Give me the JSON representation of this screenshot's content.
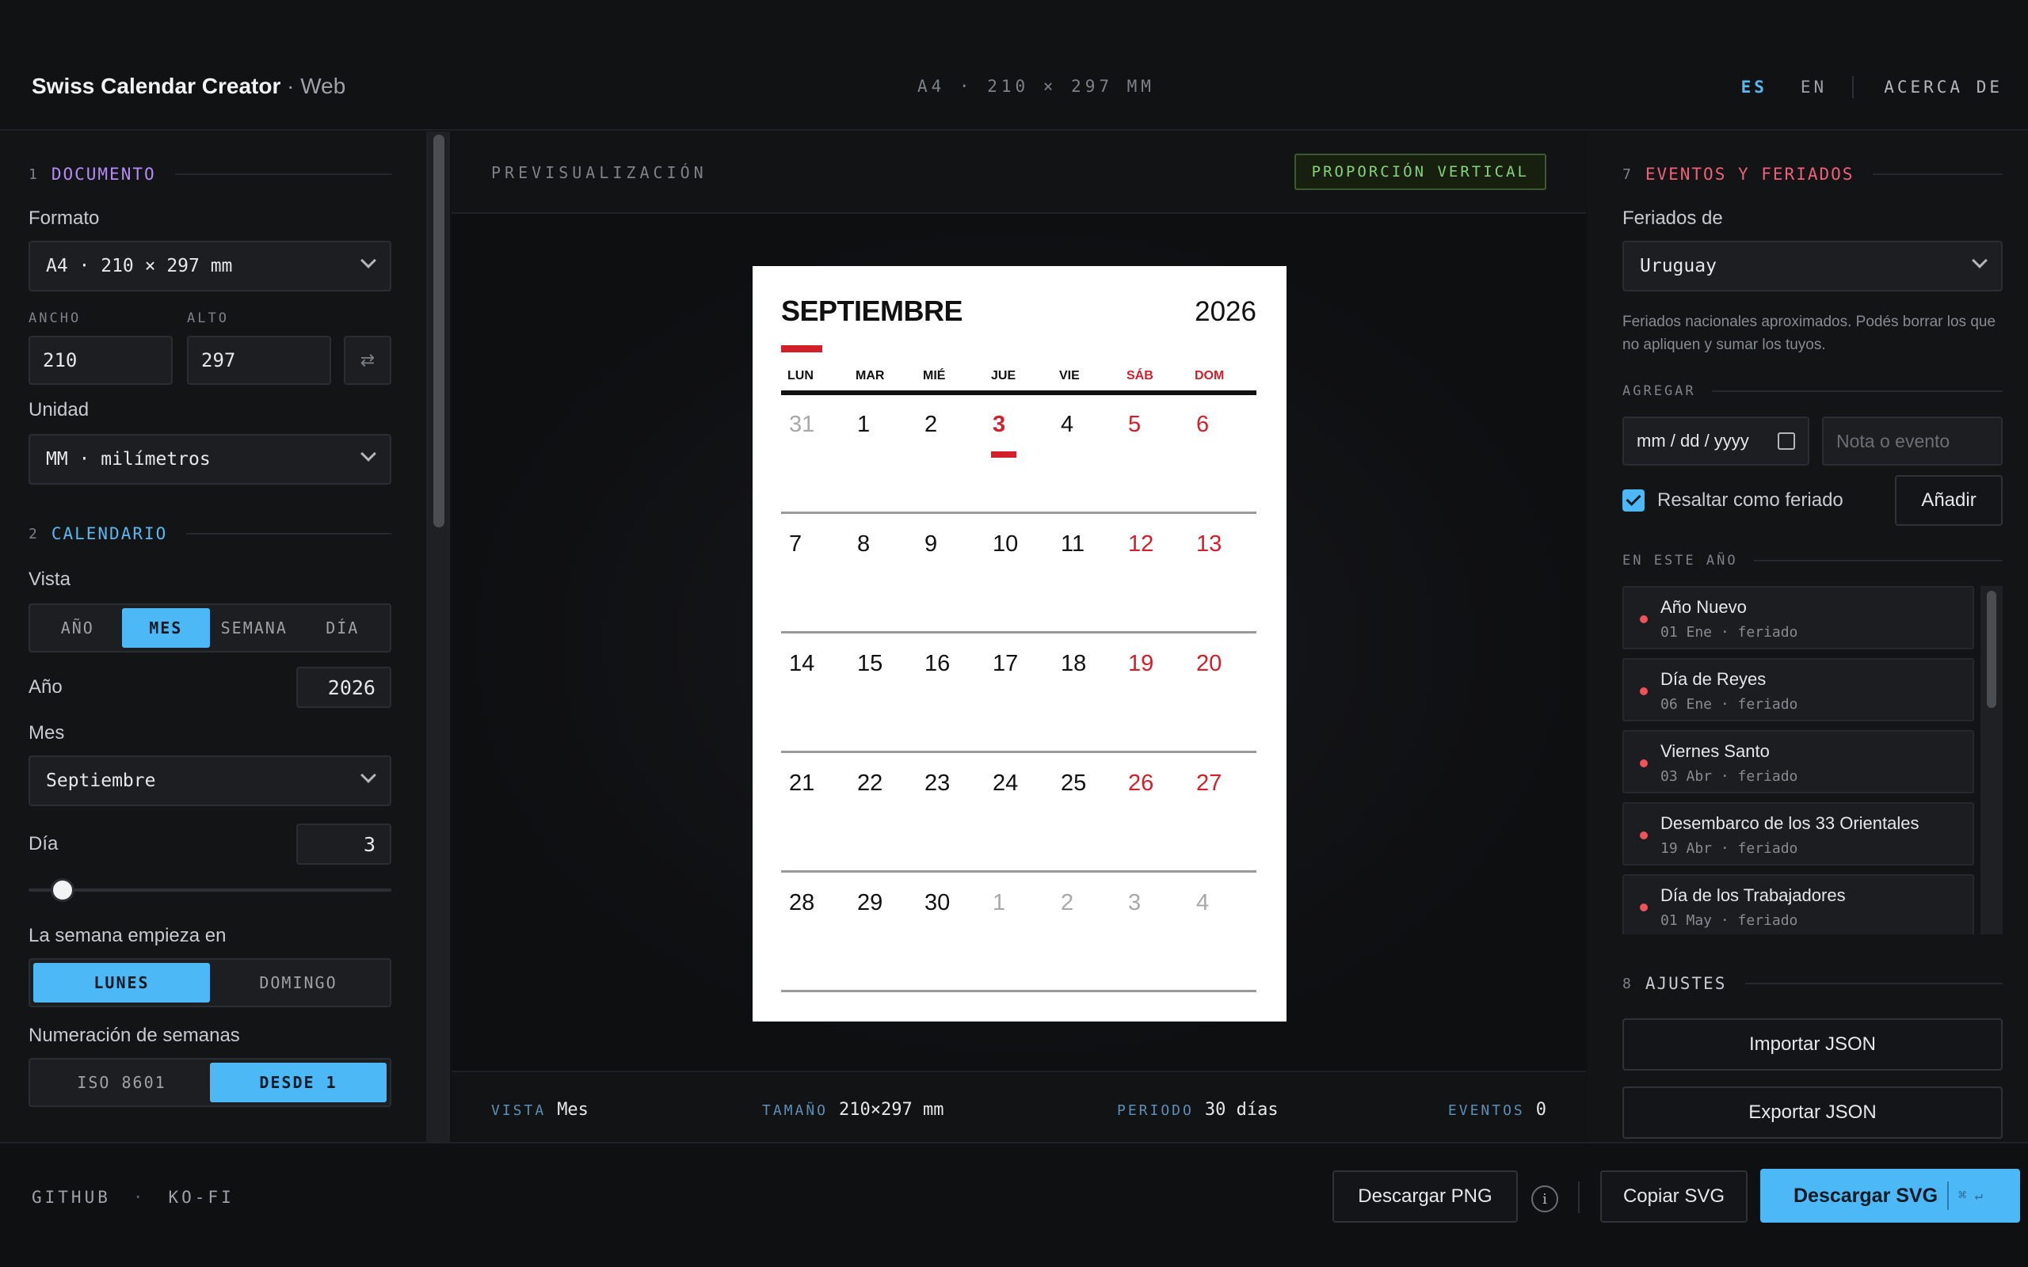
{
  "header": {
    "app_name": "Swiss Calendar Creator",
    "app_suffix": "· Web",
    "format_summary": "A4 · 210 × 297 MM",
    "lang_es": "ES",
    "lang_en": "EN",
    "about": "ACERCA DE"
  },
  "left": {
    "documento": {
      "num": "1",
      "title": "DOCUMENTO",
      "color": "#b48cf5",
      "format_label": "Formato",
      "format_value": "A4 · 210 × 297 mm",
      "width_label": "ANCHO",
      "width_value": "210",
      "height_label": "ALTO",
      "height_value": "297",
      "swap_icon": "⇄",
      "unit_label": "Unidad",
      "unit_value": "MM · milímetros"
    },
    "calendario": {
      "num": "2",
      "title": "CALENDARIO",
      "color": "#5ab8f0",
      "view_label": "Vista",
      "views": [
        "AÑO",
        "MES",
        "SEMANA",
        "DÍA"
      ],
      "active_view": "MES",
      "year_label": "Año",
      "year_value": "2026",
      "month_label": "Mes",
      "month_value": "Septiembre",
      "day_label": "Día",
      "day_value": "3",
      "week_start_label": "La semana empieza en",
      "week_start_options": [
        "LUNES",
        "DOMINGO"
      ],
      "week_start_active": "LUNES",
      "week_num_label": "Numeración de semanas",
      "week_num_options": [
        "ISO 8601",
        "DESDE 1"
      ],
      "week_num_active": "DESDE 1"
    }
  },
  "center": {
    "preview_label": "PREVISUALIZACIÓN",
    "orientation_badge": "PROPORCIÓN VERTICAL",
    "footer": {
      "vista_k": "VISTA",
      "vista_v": "Mes",
      "tamano_k": "TAMAÑO",
      "tamano_v": "210×297 mm",
      "periodo_k": "PERIODO",
      "periodo_v": "30 días",
      "eventos_k": "EVENTOS",
      "eventos_v": "0"
    },
    "calendar": {
      "month": "SEPTIEMBRE",
      "year": "2026",
      "accent_color": "#d21f2a",
      "weekdays": [
        "LUN",
        "MAR",
        "MIÉ",
        "JUE",
        "VIE",
        "SÁB",
        "DOM"
      ],
      "weeks": [
        [
          "31",
          "1",
          "2",
          "3",
          "4",
          "5",
          "6"
        ],
        [
          "7",
          "8",
          "9",
          "10",
          "11",
          "12",
          "13"
        ],
        [
          "14",
          "15",
          "16",
          "17",
          "18",
          "19",
          "20"
        ],
        [
          "21",
          "22",
          "23",
          "24",
          "25",
          "26",
          "27"
        ],
        [
          "28",
          "29",
          "30",
          "1",
          "2",
          "3",
          "4"
        ]
      ],
      "today": "3"
    }
  },
  "right": {
    "eventos": {
      "num": "7",
      "title": "EVENTOS Y FERIADOS",
      "color": "#f0607a",
      "holidays_label": "Feriados de",
      "country": "Uruguay",
      "note": "Feriados nacionales aproximados. Podés borrar los que no apliquen y sumar los tuyos.",
      "add_label": "AGREGAR",
      "date_placeholder": "mm / dd / yyyy",
      "note_placeholder": "Nota o evento",
      "highlight_label": "Resaltar como feriado",
      "add_button": "Añadir",
      "this_year_label": "EN ESTE AÑO",
      "events": [
        {
          "name": "Año Nuevo",
          "meta": "01 Ene · feriado"
        },
        {
          "name": "Día de Reyes",
          "meta": "06 Ene · feriado"
        },
        {
          "name": "Viernes Santo",
          "meta": "03 Abr · feriado"
        },
        {
          "name": "Desembarco de los 33 Orientales",
          "meta": "19 Abr · feriado"
        },
        {
          "name": "Día de los Trabajadores",
          "meta": "01 May · feriado"
        }
      ]
    },
    "ajustes": {
      "num": "8",
      "title": "AJUSTES",
      "import": "Importar JSON",
      "export": "Exportar JSON"
    }
  },
  "bottom": {
    "github": "GITHUB",
    "sep": "·",
    "kofi": "KO-FI",
    "download_png": "Descargar PNG",
    "info": "i",
    "copy_svg": "Copiar SVG",
    "download_svg": "Descargar SVG",
    "shortcut": "⌘ ↵"
  }
}
